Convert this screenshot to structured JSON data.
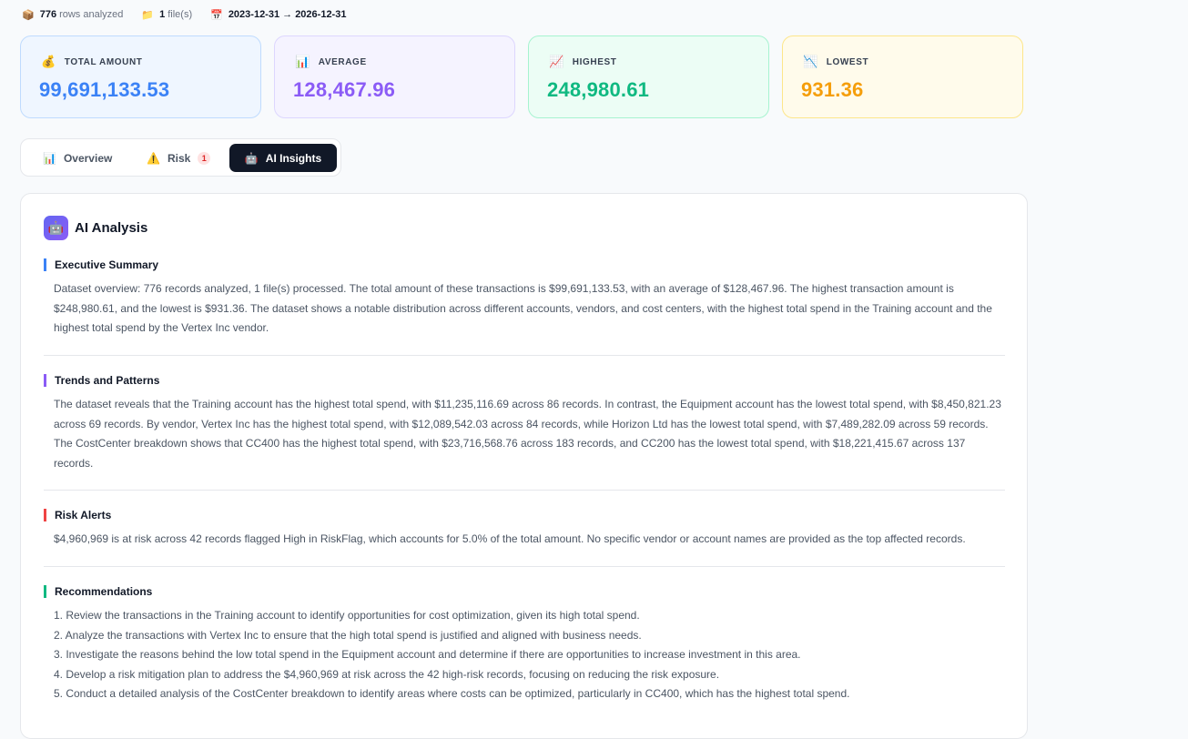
{
  "topbar": {
    "rows_value": "776",
    "rows_label": "rows analyzed",
    "files_value": "1",
    "files_label": "file(s)",
    "date_range": "2023-12-31 → 2026-12-31",
    "rows_icon": "box-icon",
    "files_icon": "folder-icon",
    "date_icon": "calendar-icon"
  },
  "cards": [
    {
      "label": "TOTAL AMOUNT",
      "value": "99,691,133.53",
      "icon": "money-bag-icon",
      "color": "#3b82f6"
    },
    {
      "label": "AVERAGE",
      "value": "128,467.96",
      "icon": "bar-chart-icon",
      "color": "#8b5cf6"
    },
    {
      "label": "HIGHEST",
      "value": "248,980.61",
      "icon": "chart-up-icon",
      "color": "#10b981"
    },
    {
      "label": "LOWEST",
      "value": "931.36",
      "icon": "chart-down-icon",
      "color": "#f59e0b"
    }
  ],
  "tabs": {
    "overview": "Overview",
    "risk": "Risk",
    "risk_badge": "1",
    "ai": "AI Insights",
    "active": "AI Insights"
  },
  "analysis": {
    "title": "AI Analysis",
    "sections": [
      {
        "title": "Executive Summary",
        "color": "#3b82f6",
        "text": "Dataset overview: 776 records analyzed, 1 file(s) processed. The total amount of these transactions is $99,691,133.53, with an average of $128,467.96. The highest transaction amount is $248,980.61, and the lowest is $931.36. The dataset shows a notable distribution across different accounts, vendors, and cost centers, with the highest total spend in the Training account and the highest total spend by the Vertex Inc vendor."
      },
      {
        "title": "Trends and Patterns",
        "color": "#8b5cf6",
        "text": "The dataset reveals that the Training account has the highest total spend, with $11,235,116.69 across 86 records. In contrast, the Equipment account has the lowest total spend, with $8,450,821.23 across 69 records. By vendor, Vertex Inc has the highest total spend, with $12,089,542.03 across 84 records, while Horizon Ltd has the lowest total spend, with $7,489,282.09 across 59 records. The CostCenter breakdown shows that CC400 has the highest total spend, with $23,716,568.76 across 183 records, and CC200 has the lowest total spend, with $18,221,415.67 across 137 records."
      },
      {
        "title": "Risk Alerts",
        "color": "#ef4444",
        "text": "$4,960,969 is at risk across 42 records flagged High in RiskFlag, which accounts for 5.0% of the total amount. No specific vendor or account names are provided as the top affected records."
      },
      {
        "title": "Recommendations",
        "color": "#10b981",
        "items": [
          "1. Review the transactions in the Training account to identify opportunities for cost optimization, given its high total spend.",
          "2. Analyze the transactions with Vertex Inc to ensure that the high total spend is justified and aligned with business needs.",
          "3. Investigate the reasons behind the low total spend in the Equipment account and determine if there are opportunities to increase investment in this area.",
          "4. Develop a risk mitigation plan to address the $4,960,969 at risk across the 42 high-risk records, focusing on reducing the risk exposure.",
          "5. Conduct a detailed analysis of the CostCenter breakdown to identify areas where costs can be optimized, particularly in CC400, which has the highest total spend."
        ]
      }
    ]
  }
}
